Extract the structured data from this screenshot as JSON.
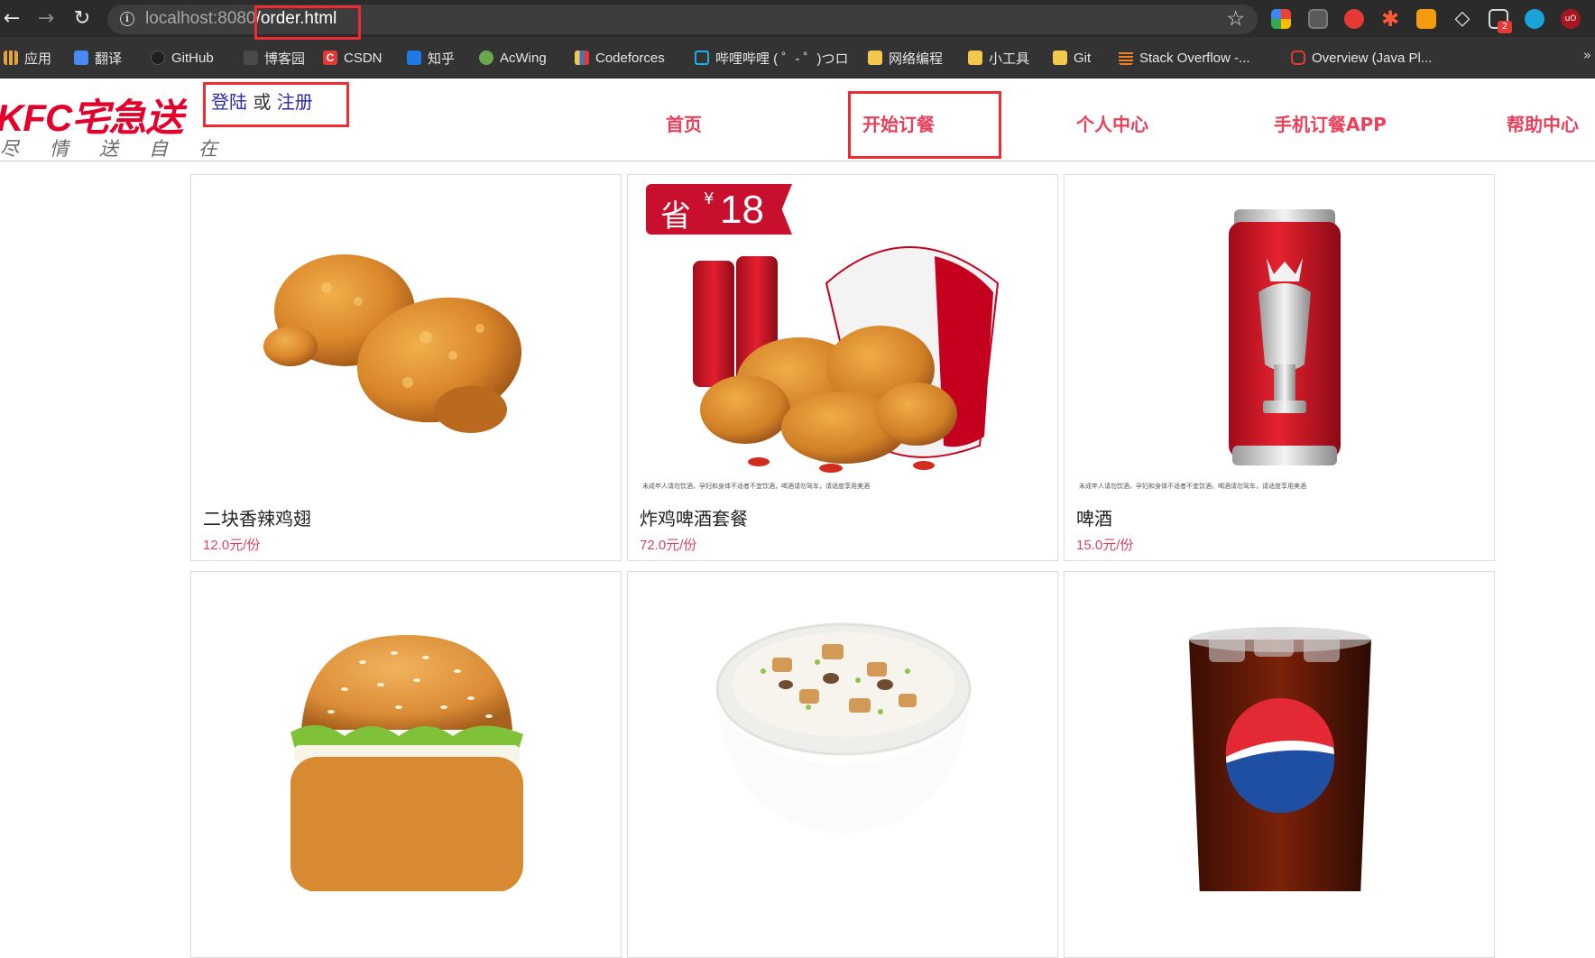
{
  "browser": {
    "url_host": "localhost:8080",
    "url_path": "/order.html",
    "extension_badge": "2"
  },
  "bookmarks": [
    {
      "label": "应用",
      "icon": "apps-grid-icon",
      "color": "#e8a33d"
    },
    {
      "label": "翻译",
      "icon": "translate-icon",
      "color": "#4a8af4"
    },
    {
      "label": "GitHub",
      "icon": "github-icon",
      "color": "#2b2b2b"
    },
    {
      "label": "博客园",
      "icon": "cnblogs-icon",
      "color": "#555555"
    },
    {
      "label": "CSDN",
      "icon": "csdn-icon",
      "color": "#e53935"
    },
    {
      "label": "知乎",
      "icon": "zhihu-icon",
      "color": "#1e7ae6"
    },
    {
      "label": "AcWing",
      "icon": "acwing-icon",
      "color": "#6aa84f"
    },
    {
      "label": "Codeforces",
      "icon": "codeforces-icon",
      "color": "#3b78c2"
    },
    {
      "label": "哔哩哔哩 ( ゜- ゜)つロ",
      "icon": "bilibili-icon",
      "color": "#23ade5"
    },
    {
      "label": "网络编程",
      "icon": "folder-icon",
      "color": "#f2c94c"
    },
    {
      "label": "小工具",
      "icon": "folder-icon",
      "color": "#f2c94c"
    },
    {
      "label": "Git",
      "icon": "folder-icon",
      "color": "#f2c94c"
    },
    {
      "label": "Stack Overflow -...",
      "icon": "stackoverflow-icon",
      "color": "#f48024"
    },
    {
      "label": "Overview (Java Pl...",
      "icon": "oracle-icon",
      "color": "#e53935"
    }
  ],
  "header": {
    "logo_text": "KFC宅急送",
    "logo_slogan": "尽情送自在",
    "login_label": "登陆",
    "or_label": "或",
    "register_label": "注册",
    "nav": [
      "首页",
      "开始订餐",
      "个人中心",
      "手机订餐APP",
      "帮助中心"
    ]
  },
  "colors": {
    "brand_red": "#e4002b",
    "nav_pink": "#e8415b",
    "price_pink": "#d9455f",
    "highlight_red": "#ee2a33"
  },
  "products": [
    {
      "name": "二块香辣鸡翅",
      "price": "12.0元/份",
      "fine_print": ""
    },
    {
      "name": "炸鸡啤酒套餐",
      "price": "72.0元/份",
      "promo_label": "省",
      "promo_currency": "¥",
      "promo_value": "18",
      "fine_print": "未成年人请勿饮酒，孕妇和身体不适者不宜饮酒，喝酒请勿驾车，请适度享用美酒"
    },
    {
      "name": "啤酒",
      "price": "15.0元/份",
      "fine_print": "未成年人请勿饮酒，孕妇和身体不适者不宜饮酒，喝酒请勿驾车，请适度享用美酒"
    },
    {
      "name": "",
      "price": "",
      "fine_print": ""
    },
    {
      "name": "",
      "price": "",
      "fine_print": ""
    },
    {
      "name": "",
      "price": "",
      "fine_print": ""
    }
  ]
}
